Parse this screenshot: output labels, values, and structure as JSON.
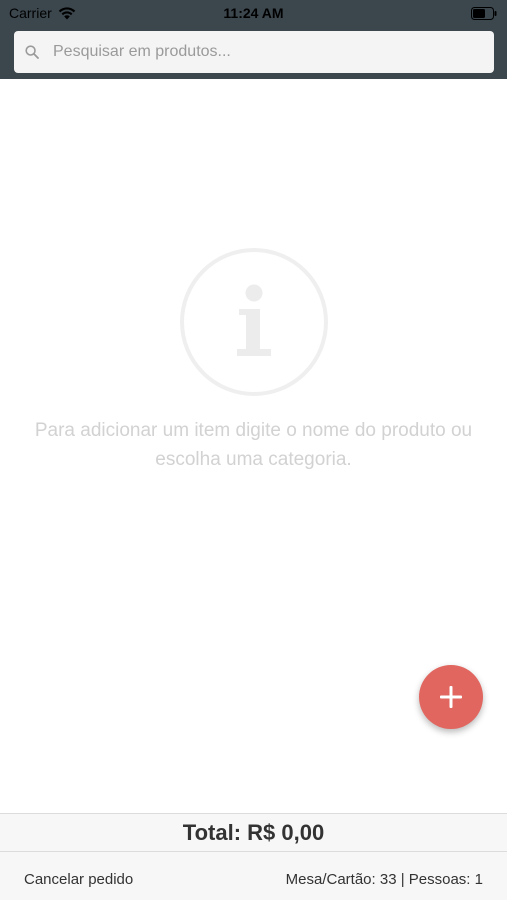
{
  "status_bar": {
    "carrier": "Carrier",
    "time": "11:24 AM",
    "wifi_icon": "wifi-icon",
    "battery_icon": "battery-icon"
  },
  "search": {
    "placeholder": "Pesquisar em produtos...",
    "value": "",
    "icon": "search-icon"
  },
  "empty_state": {
    "icon": "info-icon",
    "message": "Para adicionar um item digite o nome do produto ou escolha uma categoria."
  },
  "fab": {
    "icon": "plus-icon"
  },
  "order": {
    "total": "Total: R$ 0,00",
    "cancel_label": "Cancelar pedido",
    "table_info": "Mesa/Cartão: 33 | Pessoas: 1"
  },
  "colors": {
    "header_bg": "#3b464d",
    "fab_bg": "#e0665f",
    "empty_text": "#d2d2d2"
  }
}
